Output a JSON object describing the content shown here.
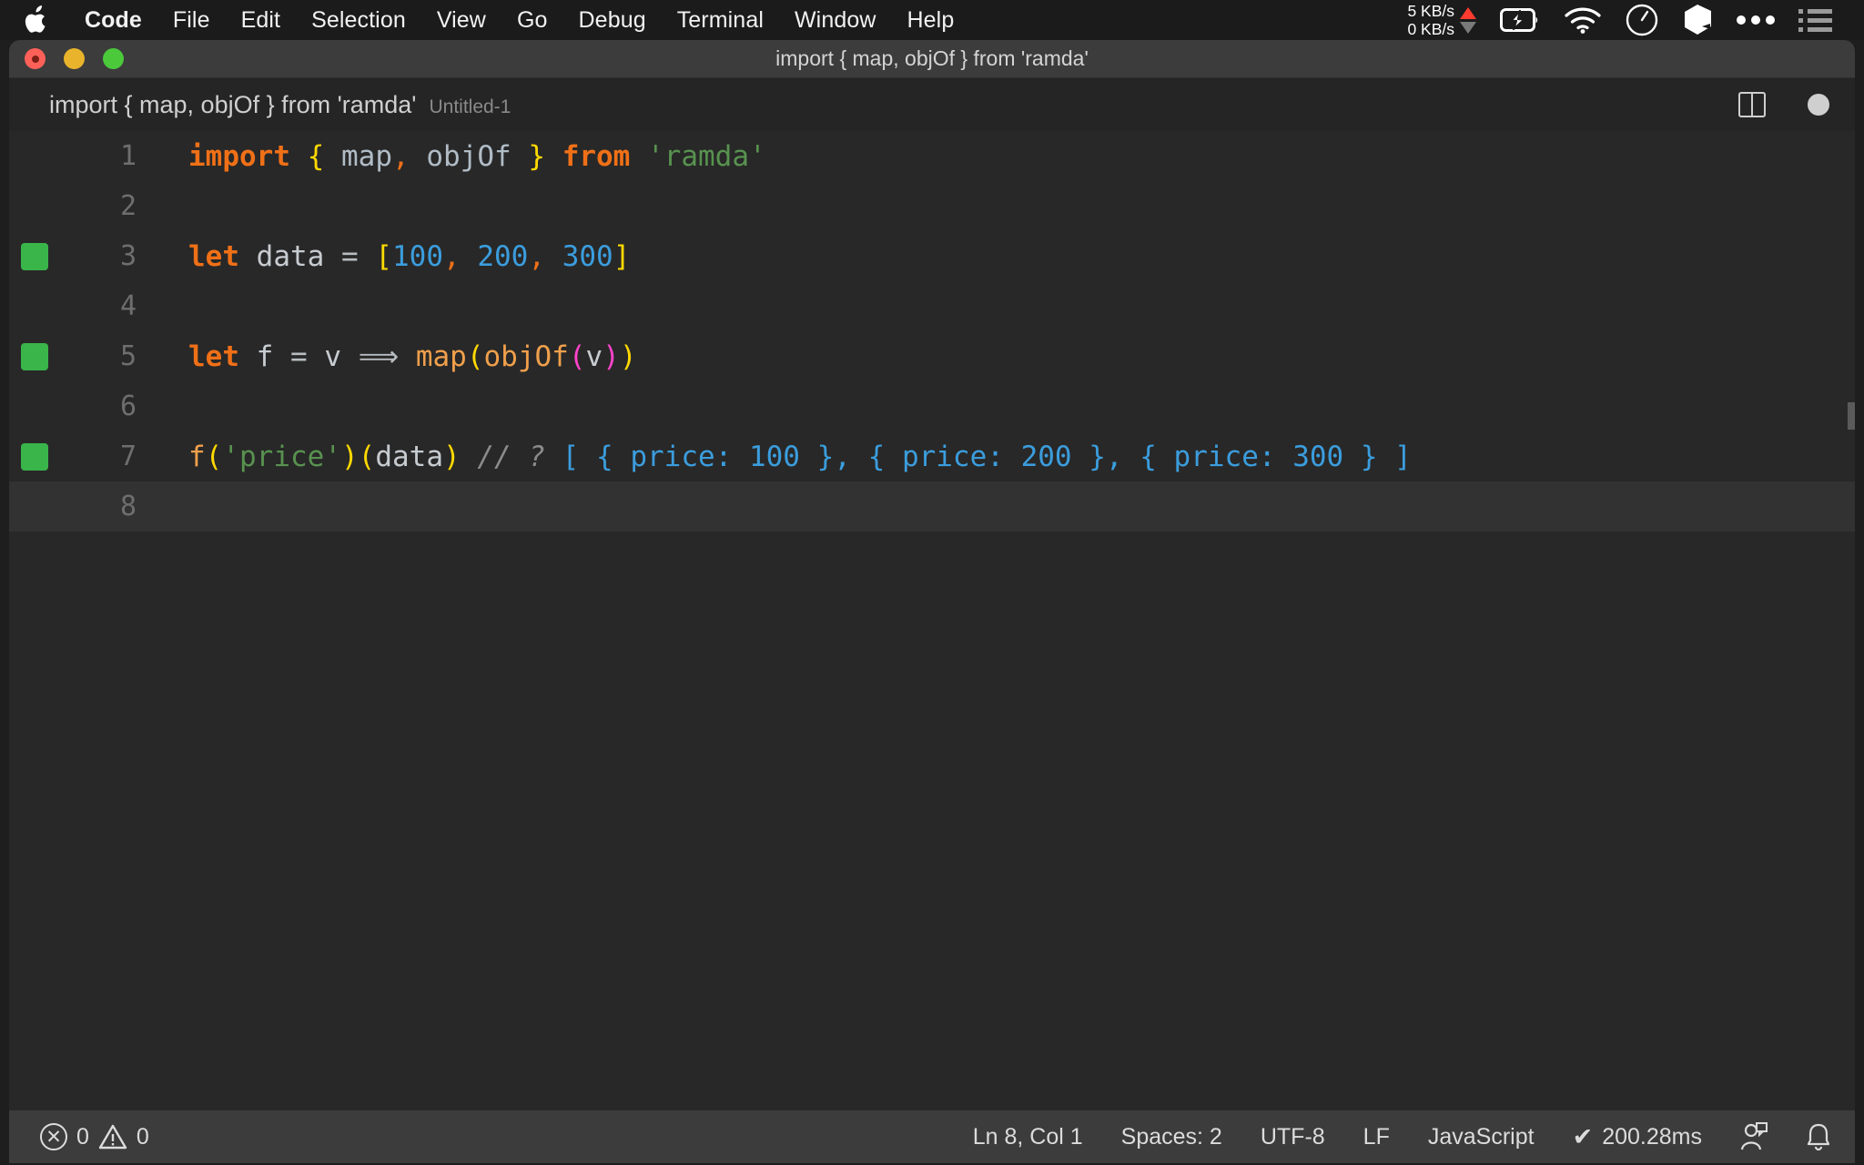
{
  "menubar": {
    "apple_icon": "apple-logo-icon",
    "items": [
      {
        "label": "Code",
        "bold": true
      },
      {
        "label": "File"
      },
      {
        "label": "Edit"
      },
      {
        "label": "Selection"
      },
      {
        "label": "View"
      },
      {
        "label": "Go"
      },
      {
        "label": "Debug"
      },
      {
        "label": "Terminal"
      },
      {
        "label": "Window"
      },
      {
        "label": "Help"
      }
    ],
    "tray": {
      "upload_speed": "5 KB/s",
      "download_speed": "0 KB/s",
      "upload_arrow_color": "#ff3b30",
      "download_arrow_color": "#7a7a7a",
      "battery_icon": "battery-charging-icon",
      "wifi_icon": "wifi-icon",
      "clock_icon": "clock-icon",
      "cube_icon": "cube-icon",
      "more_icon": "ellipsis-icon",
      "list_icon": "control-center-list-icon"
    }
  },
  "window": {
    "title": "import { map, objOf } from 'ramda'",
    "traffic_lights": {
      "close": "close-button",
      "minimize": "minimize-button",
      "zoom": "zoom-button"
    }
  },
  "editor_header": {
    "breadcrumb_main": "import { map, objOf } from 'ramda'",
    "breadcrumb_sub": "Untitled-1",
    "split_editor_icon": "split-editor-icon",
    "unsaved_indicator": "unsaved-dot-icon"
  },
  "editor": {
    "language": "JavaScript",
    "lines": [
      {
        "number": "1",
        "marker": false,
        "current": false,
        "tokens": [
          {
            "text": "import",
            "cls": "t-kw"
          },
          {
            "text": " ",
            "cls": "t-op"
          },
          {
            "text": "{",
            "cls": "t-brace-y"
          },
          {
            "text": " ",
            "cls": "t-op"
          },
          {
            "text": "map",
            "cls": "t-import-name"
          },
          {
            "text": ",",
            "cls": "t-comma"
          },
          {
            "text": " ",
            "cls": "t-op"
          },
          {
            "text": "objOf",
            "cls": "t-import-name"
          },
          {
            "text": " ",
            "cls": "t-op"
          },
          {
            "text": "}",
            "cls": "t-brace-y"
          },
          {
            "text": " ",
            "cls": "t-op"
          },
          {
            "text": "from",
            "cls": "t-kw"
          },
          {
            "text": " ",
            "cls": "t-op"
          },
          {
            "text": "'ramda'",
            "cls": "t-str"
          }
        ]
      },
      {
        "number": "2",
        "marker": false,
        "current": false,
        "tokens": []
      },
      {
        "number": "3",
        "marker": true,
        "current": false,
        "tokens": [
          {
            "text": "let",
            "cls": "t-kw"
          },
          {
            "text": " ",
            "cls": "t-op"
          },
          {
            "text": "data",
            "cls": "t-var"
          },
          {
            "text": " ",
            "cls": "t-op"
          },
          {
            "text": "=",
            "cls": "t-op"
          },
          {
            "text": " ",
            "cls": "t-op"
          },
          {
            "text": "[",
            "cls": "t-brace-y"
          },
          {
            "text": "100",
            "cls": "t-num"
          },
          {
            "text": ",",
            "cls": "t-comma"
          },
          {
            "text": " ",
            "cls": "t-op"
          },
          {
            "text": "200",
            "cls": "t-num"
          },
          {
            "text": ",",
            "cls": "t-comma"
          },
          {
            "text": " ",
            "cls": "t-op"
          },
          {
            "text": "300",
            "cls": "t-num"
          },
          {
            "text": "]",
            "cls": "t-brace-y"
          }
        ]
      },
      {
        "number": "4",
        "marker": false,
        "current": false,
        "tokens": []
      },
      {
        "number": "5",
        "marker": true,
        "current": false,
        "tokens": [
          {
            "text": "let",
            "cls": "t-kw"
          },
          {
            "text": " ",
            "cls": "t-op"
          },
          {
            "text": "f",
            "cls": "t-var"
          },
          {
            "text": " ",
            "cls": "t-op"
          },
          {
            "text": "=",
            "cls": "t-op"
          },
          {
            "text": " ",
            "cls": "t-op"
          },
          {
            "text": "v",
            "cls": "t-var"
          },
          {
            "text": " ",
            "cls": "t-op"
          },
          {
            "text": "⟹",
            "cls": "t-op"
          },
          {
            "text": " ",
            "cls": "t-op"
          },
          {
            "text": "map",
            "cls": "t-fn"
          },
          {
            "text": "(",
            "cls": "t-brace-y"
          },
          {
            "text": "objOf",
            "cls": "t-fn"
          },
          {
            "text": "(",
            "cls": "t-brace-m"
          },
          {
            "text": "v",
            "cls": "t-var"
          },
          {
            "text": ")",
            "cls": "t-brace-m"
          },
          {
            "text": ")",
            "cls": "t-brace-y"
          }
        ]
      },
      {
        "number": "6",
        "marker": false,
        "current": false,
        "tokens": []
      },
      {
        "number": "7",
        "marker": true,
        "current": false,
        "tokens": [
          {
            "text": "f",
            "cls": "t-fn"
          },
          {
            "text": "(",
            "cls": "t-brace-y"
          },
          {
            "text": "'price'",
            "cls": "t-str"
          },
          {
            "text": ")",
            "cls": "t-brace-y"
          },
          {
            "text": "(",
            "cls": "t-brace-y"
          },
          {
            "text": "data",
            "cls": "t-var"
          },
          {
            "text": ")",
            "cls": "t-brace-y"
          },
          {
            "text": " ",
            "cls": "t-op"
          },
          {
            "text": "// ?",
            "cls": "t-comment"
          },
          {
            "text": " ",
            "cls": "t-op"
          },
          {
            "text": "[ { price: 100 }, { price: 200 }, { price: 300 } ]",
            "cls": "t-result"
          }
        ]
      },
      {
        "number": "8",
        "marker": false,
        "current": true,
        "tokens": []
      }
    ]
  },
  "statusbar": {
    "errors": "0",
    "warnings": "0",
    "error_icon": "error-circle-icon",
    "warning_icon": "warning-triangle-icon",
    "position": "Ln 8, Col 1",
    "indentation": "Spaces: 2",
    "encoding": "UTF-8",
    "eol": "LF",
    "language": "JavaScript",
    "runtime_check": "✔",
    "runtime": "200.28ms",
    "feedback_icon": "feedback-smiley-icon",
    "bell_icon": "notification-bell-icon"
  }
}
